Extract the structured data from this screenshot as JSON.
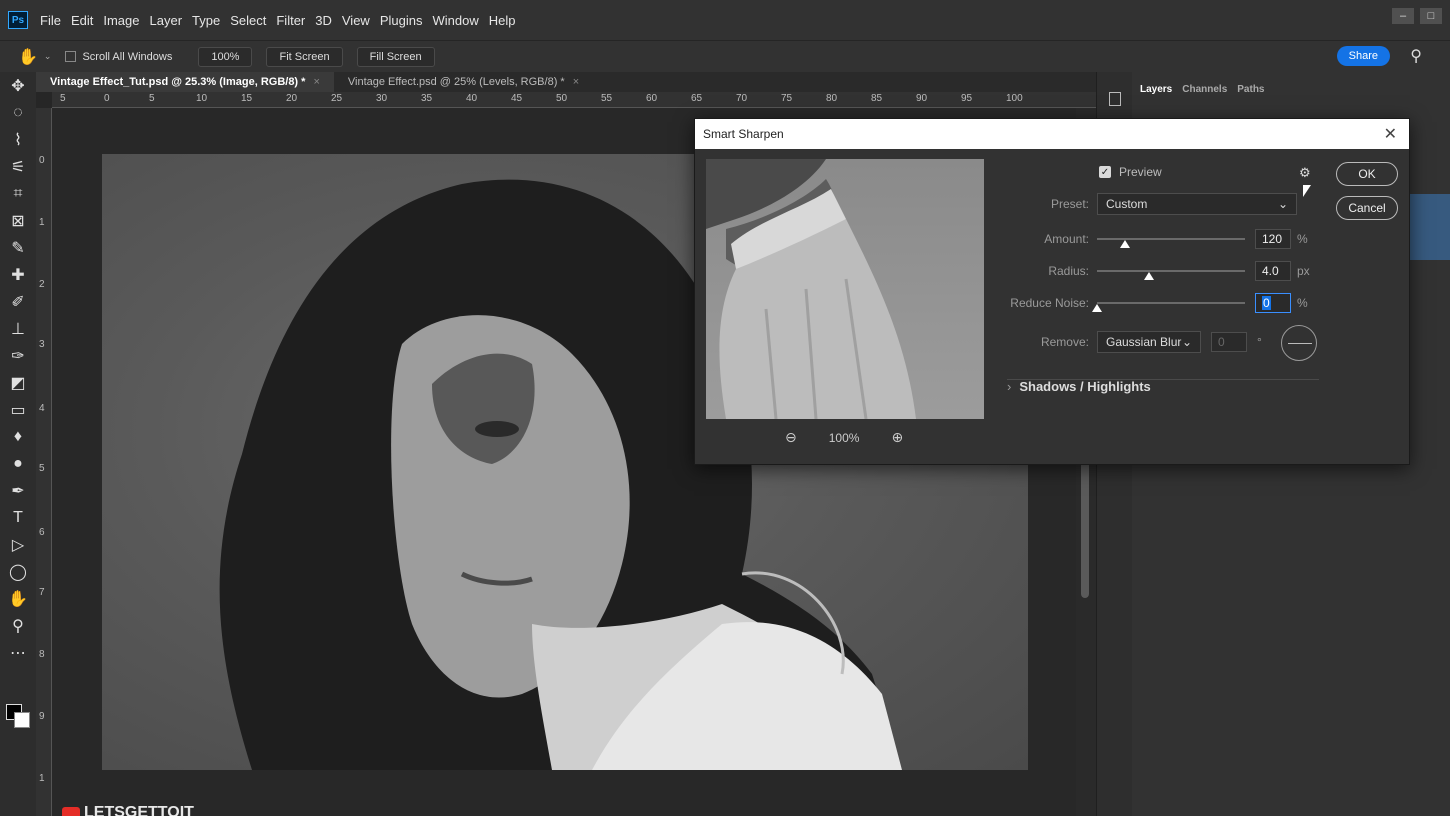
{
  "app": {
    "menu": [
      "File",
      "Edit",
      "Image",
      "Layer",
      "Type",
      "Select",
      "Filter",
      "3D",
      "View",
      "Plugins",
      "Window",
      "Help"
    ],
    "logo_text": "Ps"
  },
  "options_bar": {
    "scroll_all_windows": "Scroll All Windows",
    "zoom_100": "100%",
    "fit_screen": "Fit Screen",
    "fill_screen": "Fill Screen",
    "share": "Share"
  },
  "doc_tabs": [
    {
      "label": "Vintage Effect_Tut.psd @ 25.3% (Image, RGB/8) *",
      "active": true
    },
    {
      "label": "Vintage Effect.psd @ 25% (Levels, RGB/8) *",
      "active": false
    }
  ],
  "ruler_h": [
    "5",
    "0",
    "5",
    "10",
    "15",
    "20",
    "25",
    "30",
    "35",
    "40",
    "45",
    "50",
    "55",
    "60",
    "65",
    "70",
    "75",
    "80",
    "85",
    "90",
    "95",
    "100"
  ],
  "ruler_v": [
    "0",
    "1",
    "2",
    "3",
    "4",
    "5",
    "6",
    "7",
    "8",
    "9",
    "1"
  ],
  "panels": {
    "tabs": [
      "Layers",
      "Channels",
      "Paths"
    ]
  },
  "canvas": {
    "brand": "LETSGETTOIT"
  },
  "dialog": {
    "title": "Smart Sharpen",
    "preview_label": "Preview",
    "preview_checked": true,
    "ok": "OK",
    "cancel": "Cancel",
    "preset_label": "Preset:",
    "preset_value": "Custom",
    "amount_label": "Amount:",
    "amount_value": "120",
    "amount_unit": "%",
    "amount_level": 0.19,
    "radius_label": "Radius:",
    "radius_value": "4.0",
    "radius_unit": "px",
    "radius_level": 0.35,
    "noise_label": "Reduce Noise:",
    "noise_value": "0",
    "noise_unit": "%",
    "noise_level": 0.0,
    "remove_label": "Remove:",
    "remove_value": "Gaussian Blur",
    "angle_value": "0",
    "angle_unit": "°",
    "section_shadows": "Shadows / Highlights",
    "zoom_level": "100%"
  }
}
